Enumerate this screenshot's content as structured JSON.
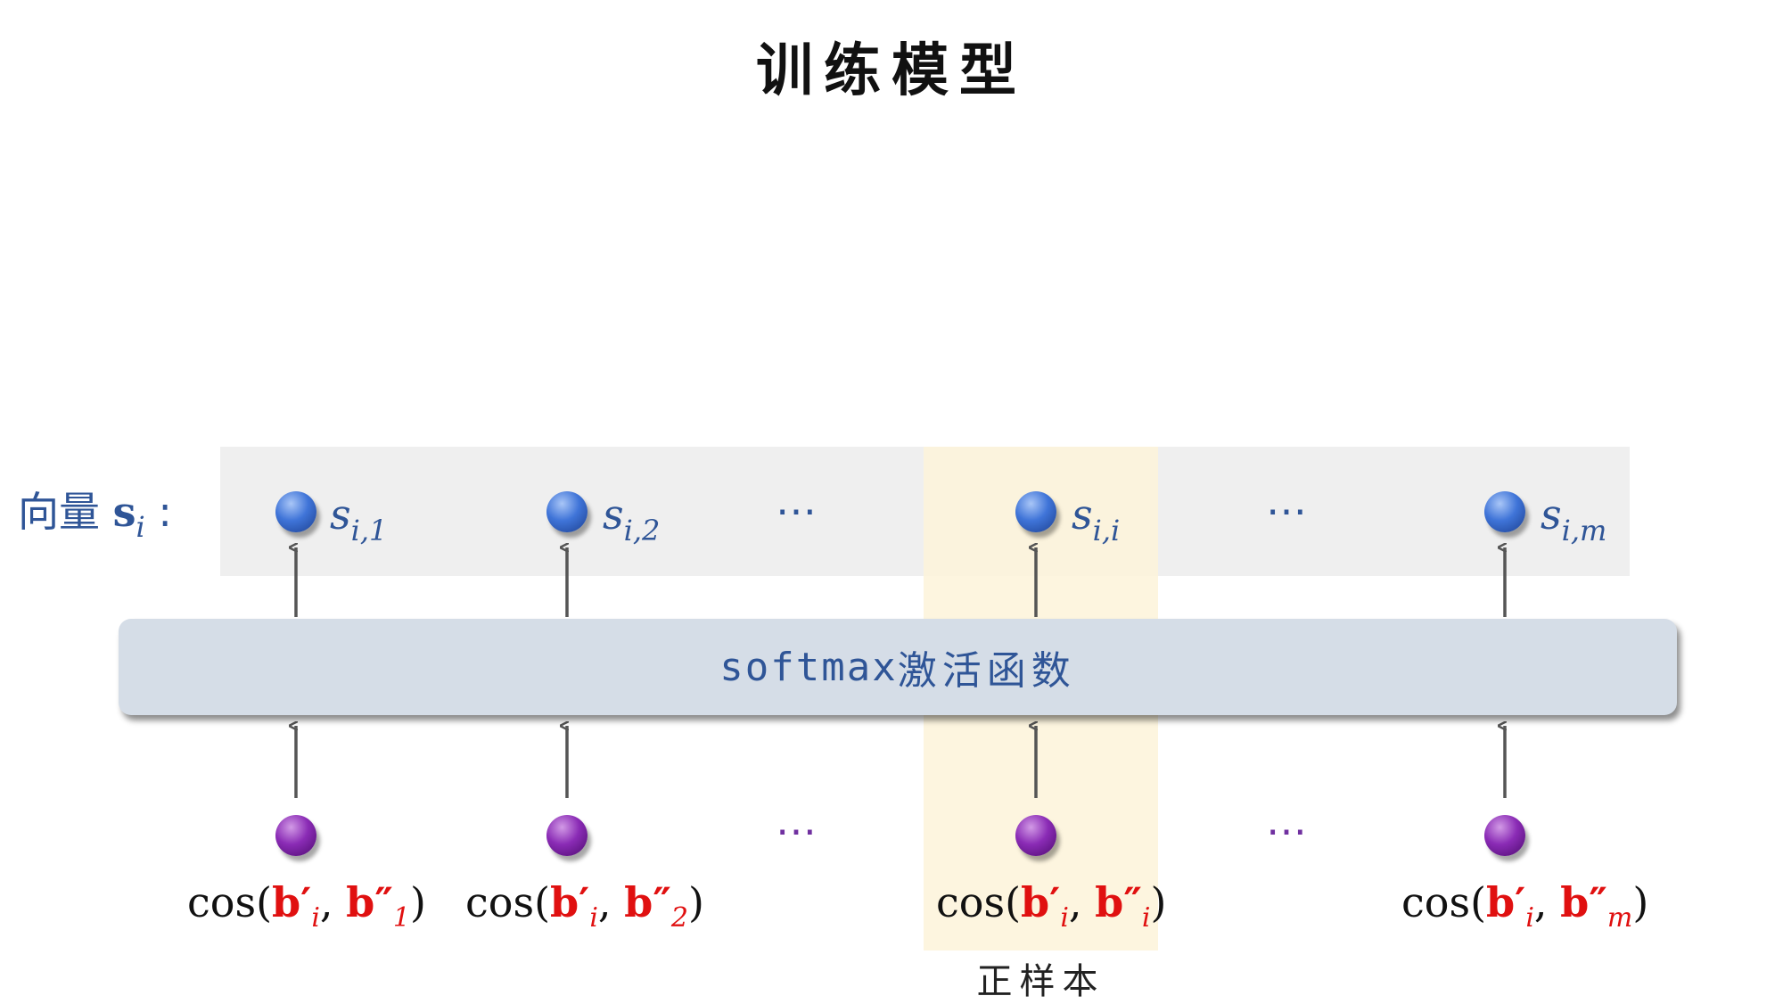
{
  "title": "训练模型",
  "vector_label": {
    "prefix": "向量 ",
    "symbol": "s",
    "sub": "i",
    "colon": " :"
  },
  "softmax": {
    "fn": "softmax",
    "text": "激活函数"
  },
  "outputs": [
    {
      "symbol": "s",
      "sub": "i,1"
    },
    {
      "symbol": "s",
      "sub": "i,2"
    },
    {
      "symbol": "s",
      "sub": "i,i"
    },
    {
      "symbol": "s",
      "sub": "i,m"
    }
  ],
  "inputs": [
    {
      "fn": "cos(",
      "a": "b′",
      "a_sub": "i",
      "sep": ", ",
      "b": "b″",
      "b_sub": "1",
      "close": ")"
    },
    {
      "fn": "cos(",
      "a": "b′",
      "a_sub": "i",
      "sep": ", ",
      "b": "b″",
      "b_sub": "2",
      "close": ")"
    },
    {
      "fn": "cos(",
      "a": "b′",
      "a_sub": "i",
      "sep": ", ",
      "b": "b″",
      "b_sub": "i",
      "close": ")"
    },
    {
      "fn": "cos(",
      "a": "b′",
      "a_sub": "i",
      "sep": ", ",
      "b": "b″",
      "b_sub": "m",
      "close": ")"
    }
  ],
  "ellipsis": "⋯",
  "positive_label": "正样本",
  "colors": {
    "accent_blue": "#2f5597",
    "red": "#e01010",
    "purple": "#7030a0",
    "highlight": "#fdf3d9"
  }
}
